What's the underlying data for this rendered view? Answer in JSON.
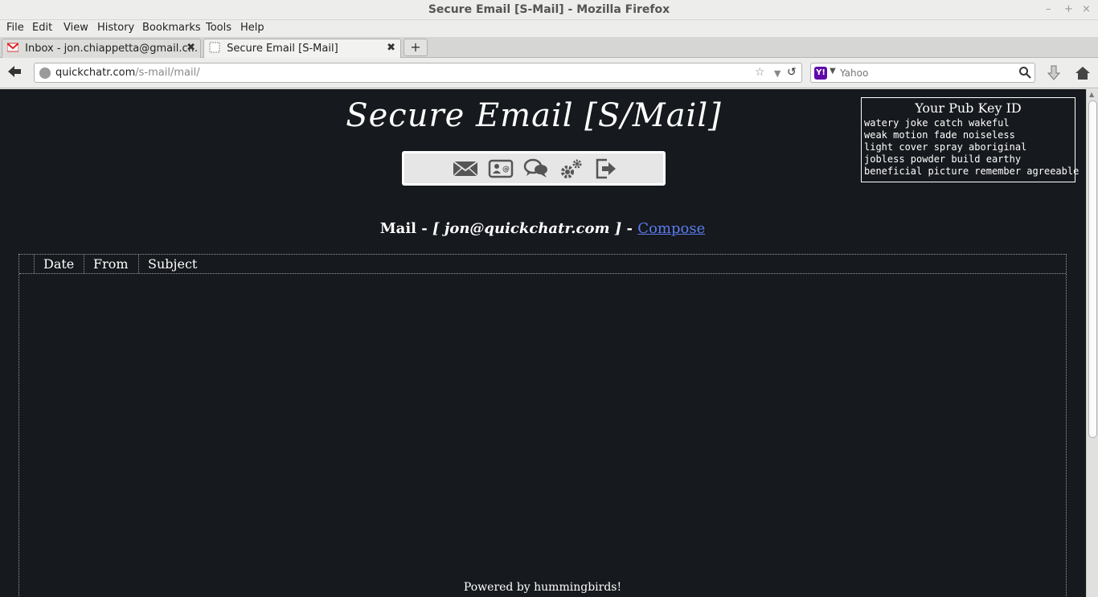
{
  "window": {
    "title": "Secure Email [S-Mail] - Mozilla Firefox",
    "controls": [
      "–",
      "+",
      "×"
    ]
  },
  "menubar": {
    "items": [
      "File",
      "Edit",
      "View",
      "History",
      "Bookmarks",
      "Tools",
      "Help"
    ]
  },
  "tabs": [
    {
      "label": "Inbox - jon.chiappetta@gmail.c...",
      "icon": "gmail-icon",
      "active": false
    },
    {
      "label": "Secure Email [S-Mail]",
      "icon": "blank-page-icon",
      "active": true
    }
  ],
  "newtab_label": "+",
  "navbar": {
    "url_host": "quickchatr.com",
    "url_path": "/s-mail/mail/",
    "search_placeholder": "Yahoo",
    "search_engine_logo": "Y!"
  },
  "page": {
    "site_title": "Secure Email [S/Mail]",
    "toolbar_icons": [
      "mail-icon",
      "contacts-icon",
      "chat-icon",
      "settings-icon",
      "logout-icon"
    ],
    "heading_prefix": "Mail - ",
    "heading_address": "[ jon@quickchatr.com ]",
    "heading_sep": " - ",
    "compose_link": "Compose",
    "pubkey": {
      "title": "Your Pub Key ID",
      "words": [
        "watery joke catch wakeful",
        "weak motion fade noiseless",
        "light cover spray aboriginal",
        "jobless powder build earthy",
        "beneficial picture remember agreeable"
      ]
    },
    "table_headers": [
      "",
      "Date",
      "From",
      "Subject"
    ],
    "footer": "Powered by hummingbirds!"
  },
  "colors": {
    "page_bg": "#16191d",
    "link": "#5a7cf0",
    "toolbar_bg": "#e6e6e6"
  }
}
